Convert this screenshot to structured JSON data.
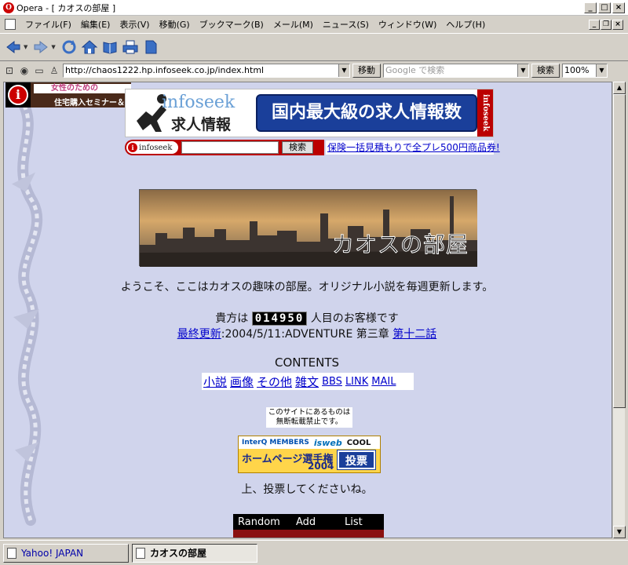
{
  "window": {
    "title": "Opera - [ カオスの部屋 ]"
  },
  "menu": {
    "items": [
      "ファイル(F)",
      "編集(E)",
      "表示(V)",
      "移動(G)",
      "ブックマーク(B)",
      "メール(M)",
      "ニュース(S)",
      "ウィンドウ(W)",
      "ヘルプ(H)"
    ]
  },
  "toolbar": {
    "buttons": [
      "back-icon",
      "forward-icon",
      "reload-icon",
      "home-icon",
      "hotlist-icon",
      "print-icon",
      "page-icon"
    ]
  },
  "address": {
    "url": "http://chaos1222.hp.infoseek.co.jp/index.html",
    "go_label": "移動",
    "search_placeholder": "Google で検索",
    "search_label": "検索",
    "zoom": "100%"
  },
  "page": {
    "ad_left": {
      "line1": "女性のための",
      "line2": "住宅購入セミナー＆"
    },
    "infoseek_banner": {
      "word": "infoseek",
      "jp": "求人情報",
      "main": "国内最大級の求人情報数",
      "vertical": "infoseek"
    },
    "infoseek_search": {
      "logo": "infoseek",
      "button": "検索"
    },
    "promo_link": "保険一括見積もりで全プレ500円商品券!",
    "site_title": "カオスの部屋",
    "welcome": "ようこそ、ここはカオスの趣味の部屋。オリジナル小説を毎週更新します。",
    "visitor": {
      "prefix": "貴方は",
      "count": "014950",
      "suffix": "人目のお客様です"
    },
    "update": {
      "link": "最終更新",
      "text": ":2004/5/11:ADVENTURE 第三章",
      "chapter_link": "第十二話"
    },
    "contents_heading": "CONTENTS",
    "contents_links": [
      "小説",
      "画像",
      "その他",
      "雑文",
      "BBS",
      "LINK",
      "MAIL"
    ],
    "notice": {
      "line1": "このサイトにあるものは",
      "line2": "無断転載禁止です。"
    },
    "vote_banner": {
      "interq": "InterQ MEMBERS",
      "isweb": "isweb",
      "cool": "COOL",
      "title": "ホームページ選手権",
      "year": "2004",
      "button": "投票"
    },
    "vote_text": "上、投票してくださいね。",
    "nav": [
      "Random",
      "Add",
      "List"
    ]
  },
  "taskbar": {
    "tasks": [
      {
        "label": "Yahoo!  JAPAN",
        "active": false
      },
      {
        "label": "カオスの部屋",
        "active": true
      }
    ]
  }
}
